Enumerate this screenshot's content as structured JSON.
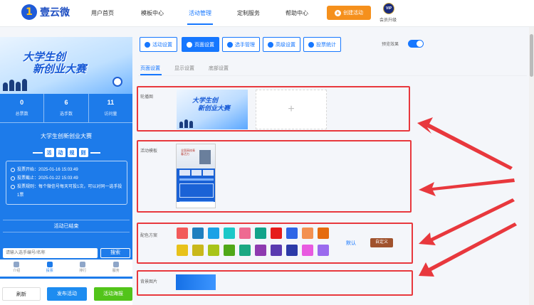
{
  "brand": {
    "name": "壹云微",
    "logo_glyph": "1"
  },
  "nav": {
    "items": [
      {
        "label": "用户首页",
        "active": false
      },
      {
        "label": "模板中心",
        "active": false
      },
      {
        "label": "活动管理",
        "active": true
      },
      {
        "label": "定制服务",
        "active": false
      },
      {
        "label": "帮助中心",
        "active": false
      }
    ],
    "create_label": "创建活动",
    "vip_badge": "VIP",
    "vip_label": "会员升级"
  },
  "preview": {
    "banner_title_1": "大学生创",
    "banner_title_2": "新创业大赛",
    "stats": [
      {
        "value": "0",
        "label": "总票数"
      },
      {
        "value": "6",
        "label": "选手数"
      },
      {
        "value": "11",
        "label": "访问量"
      }
    ],
    "event_name": "大学生创新创业大赛",
    "rules_chars": [
      "活",
      "动",
      "规",
      "则"
    ],
    "rules": [
      {
        "text": "投票开始：2025-01-16 15:03:49"
      },
      {
        "text": "投票截止：2025-01-22 15:03:49"
      },
      {
        "text": "投票规则：每个微信号每天可投1次，可以对同一选手投1票"
      }
    ],
    "ended_label": "活动已结束",
    "search_placeholder": "请输入选手编号/名称",
    "search_button": "搜索",
    "tabs": [
      {
        "label": "介绍",
        "active": false
      },
      {
        "label": "投票",
        "active": true
      },
      {
        "label": "排行",
        "active": false
      },
      {
        "label": "服务",
        "active": false
      }
    ]
  },
  "actions": {
    "refresh": "刷新",
    "publish": "发布活动",
    "poster": "活动海报"
  },
  "toolbar": {
    "buttons": [
      {
        "label": "活动设置",
        "active": false
      },
      {
        "label": "页面设置",
        "active": true
      },
      {
        "label": "选手管理",
        "active": false
      },
      {
        "label": "高级设置",
        "active": false
      },
      {
        "label": "投票统计",
        "active": false
      }
    ],
    "preview_effect_label": "预览效果",
    "preview_effect_on": true
  },
  "subtabs": [
    {
      "label": "页面设置",
      "active": true
    },
    {
      "label": "显示设置",
      "active": false
    },
    {
      "label": "底部设置",
      "active": false
    }
  ],
  "sections": {
    "carousel_label": "轮播图",
    "carousel_title_1": "大学生创",
    "carousel_title_2": "新创业大赛",
    "add_glyph": "+",
    "template_label": "活动模板",
    "template_thumb_title": "全国高校青春活力",
    "color_label": "配色方案",
    "default_label": "默认",
    "custom_label": "自定义",
    "bg_label": "背景图片"
  },
  "colors": {
    "accent": "#1677ff",
    "highlight_box": "#e8383d",
    "swatches_row1": [
      "#f25a5a",
      "#1f7fbf",
      "#1aa2e6",
      "#1cc8c8",
      "#ee6a91",
      "#12a38a",
      "#e61c1c",
      "#2f65e6",
      "#f39050",
      "#e56c10"
    ],
    "swatches_row2": [
      "#e8c21a",
      "#c9b81a",
      "#a8c418",
      "#50a818",
      "#1aa882",
      "#8e3ab0",
      "#5a3ab0",
      "#2c3aa8",
      "#e85ae0",
      "#9a6aee"
    ]
  }
}
